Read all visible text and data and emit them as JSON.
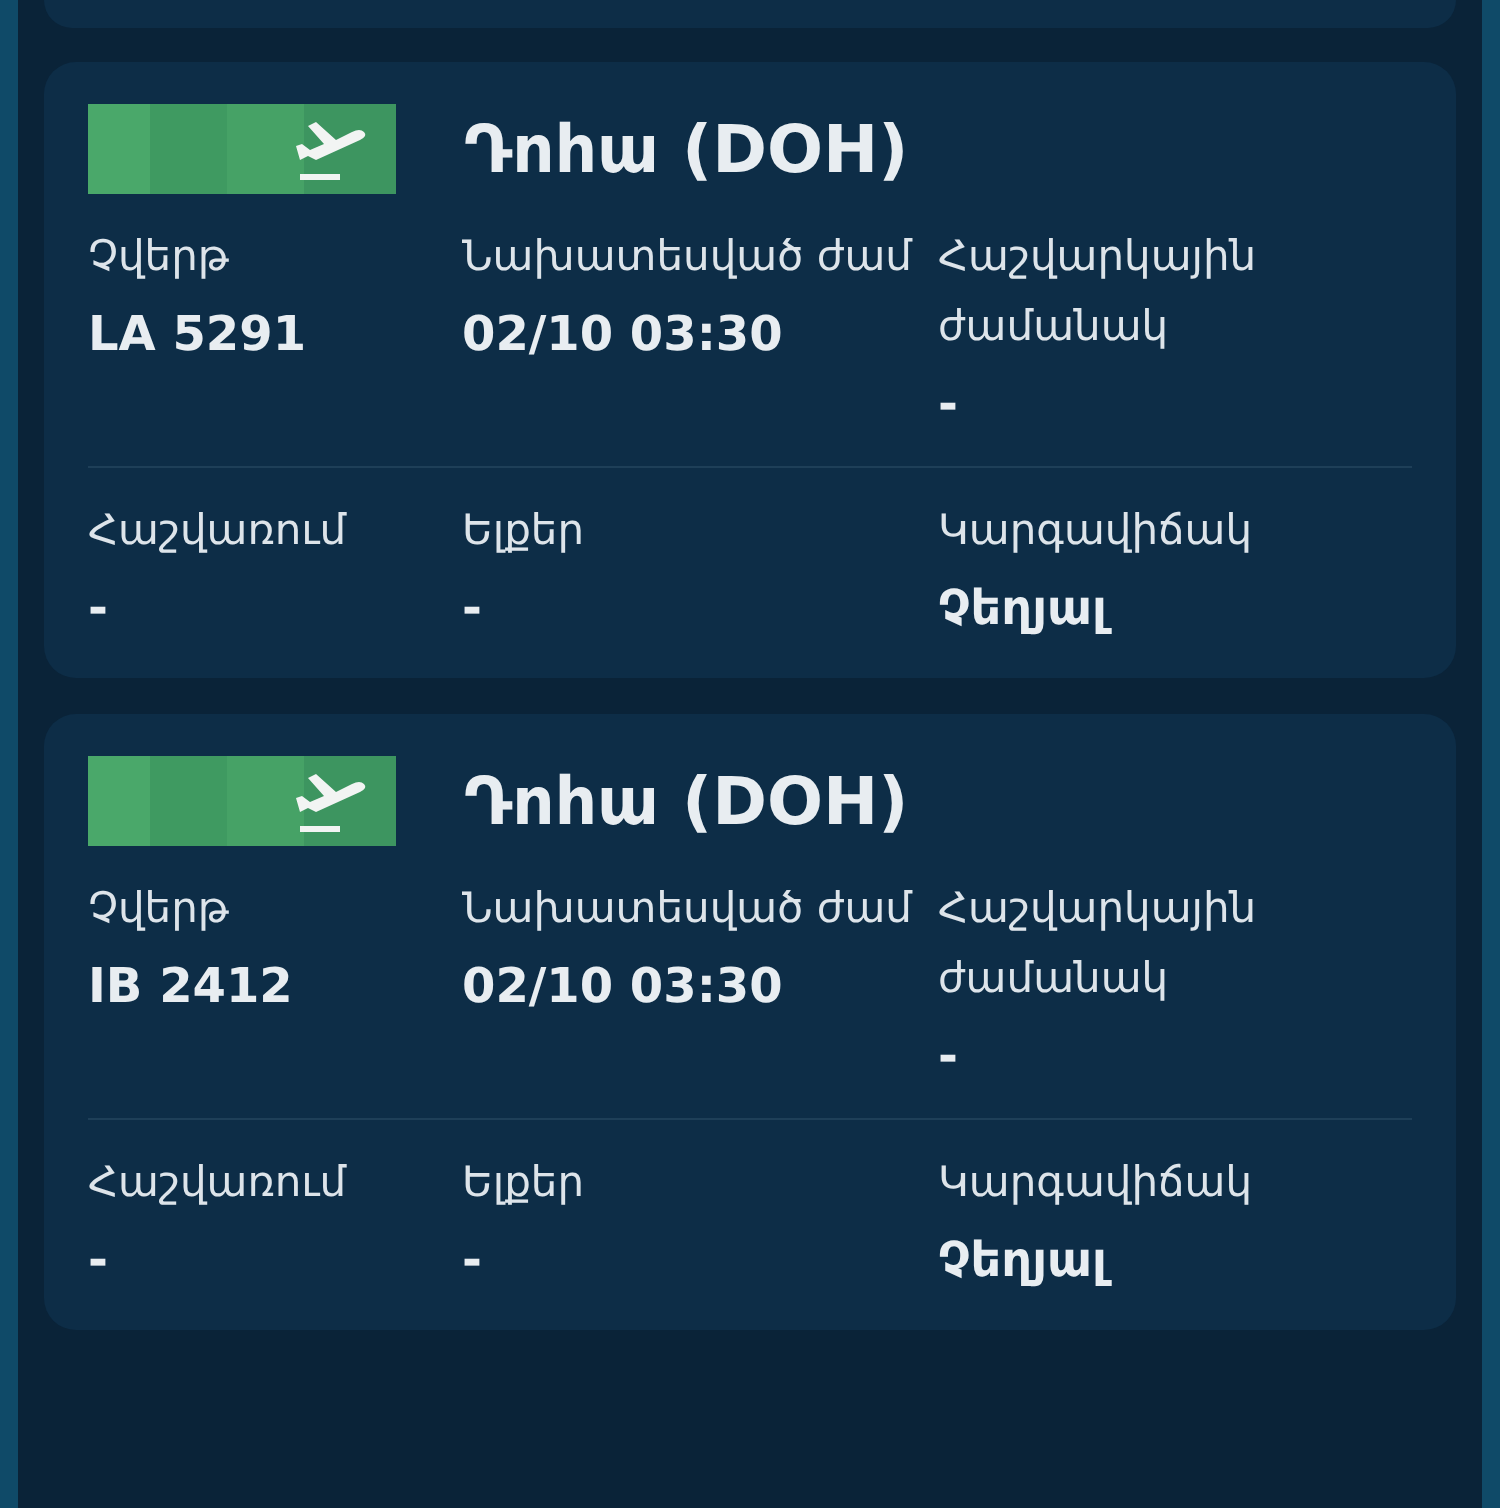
{
  "flights": [
    {
      "destination": "Դոհա (DOH)",
      "rows": [
        [
          {
            "label": "Չվերթ",
            "value": "LA 5291"
          },
          {
            "label": "Նախատեսված ժամ",
            "value": "02/10 03:30"
          },
          {
            "label": "Հաշվարկային ժամանակ",
            "value": "-"
          }
        ],
        [
          {
            "label": "Հաշվառում",
            "value": "-"
          },
          {
            "label": "Ելքեր",
            "value": "-"
          },
          {
            "label": "Կարգավիճակ",
            "value": "Չեղյալ"
          }
        ]
      ]
    },
    {
      "destination": "Դոհա (DOH)",
      "rows": [
        [
          {
            "label": "Չվերթ",
            "value": "IB 2412"
          },
          {
            "label": "Նախատեսված ժամ",
            "value": "02/10 03:30"
          },
          {
            "label": "Հաշվարկային ժամանակ",
            "value": "-"
          }
        ],
        [
          {
            "label": "Հաշվառում",
            "value": "-"
          },
          {
            "label": "Ելքեր",
            "value": "-"
          },
          {
            "label": "Կարգավիճակ",
            "value": "Չեղյալ"
          }
        ]
      ]
    }
  ]
}
